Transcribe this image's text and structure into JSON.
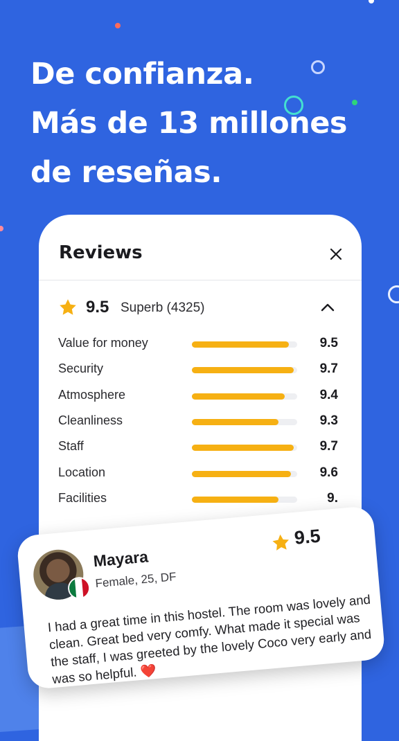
{
  "headline": {
    "lines": [
      "De confianza.",
      "Más de 13 millones",
      "de reseñas."
    ]
  },
  "reviews_panel": {
    "title": "Reviews",
    "overall": {
      "score": "9.5",
      "label": "Superb (4325)"
    },
    "categories": [
      {
        "label": "Value for money",
        "value": "9.5",
        "fill": 0.92
      },
      {
        "label": "Security",
        "value": "9.7",
        "fill": 0.97
      },
      {
        "label": "Atmosphere",
        "value": "9.4",
        "fill": 0.88
      },
      {
        "label": "Cleanliness",
        "value": "9.3",
        "fill": 0.82
      },
      {
        "label": "Staff",
        "value": "9.7",
        "fill": 0.97
      },
      {
        "label": "Location",
        "value": "9.6",
        "fill": 0.94
      },
      {
        "label": "Facilities",
        "value": "9.",
        "fill": 0.82
      }
    ]
  },
  "review_card": {
    "name": "Mayara",
    "meta": "Female, 25, DF",
    "score": "9.5",
    "text": "I had a great time in this hostel. The room was lovely and clean. Great bed very comfy. What made it special was the staff, I was greeted by the lovely Coco very early and was so helpful.",
    "emoji": "❤️"
  },
  "colors": {
    "background": "#2f64e0",
    "star": "#f6b013",
    "bar_fill": "#f6b013",
    "bar_track": "#eeeff2",
    "heart": "#e02433"
  },
  "icons": [
    "star-icon",
    "close-icon",
    "chevron-up-icon",
    "mexico-flag-icon",
    "heart-emoji"
  ]
}
